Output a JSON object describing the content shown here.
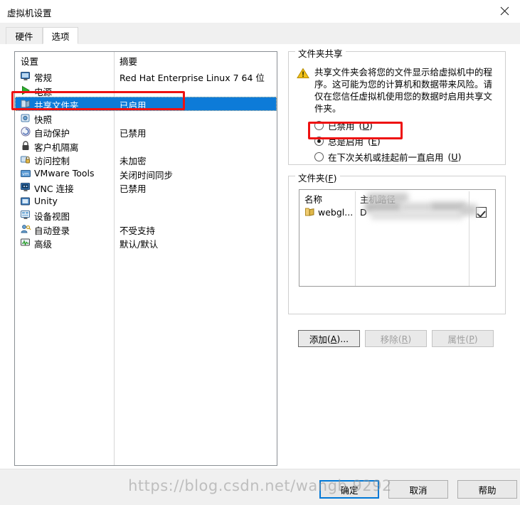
{
  "window": {
    "title": "虚拟机设置",
    "close_icon": "close-icon"
  },
  "tabs": [
    {
      "label": "硬件",
      "active": false
    },
    {
      "label": "选项",
      "active": true
    }
  ],
  "settings_list": {
    "headers": {
      "name": "设置",
      "summary": "摘要"
    },
    "rows": [
      {
        "icon": "monitor-icon",
        "label": "常规",
        "summary": "Red Hat Enterprise Linux 7 64 位",
        "selected": false
      },
      {
        "icon": "play-icon",
        "label": "电源",
        "summary": "",
        "selected": false
      },
      {
        "icon": "folder-icon",
        "label": "共享文件夹",
        "summary": "已启用",
        "selected": true
      },
      {
        "icon": "snapshot-icon",
        "label": "快照",
        "summary": "",
        "selected": false
      },
      {
        "icon": "autoprotect-icon",
        "label": "自动保护",
        "summary": "已禁用",
        "selected": false
      },
      {
        "icon": "lock-icon",
        "label": "客户机隔离",
        "summary": "",
        "selected": false
      },
      {
        "icon": "access-control-icon",
        "label": "访问控制",
        "summary": "未加密",
        "selected": false
      },
      {
        "icon": "vmware-tools-icon",
        "label": "VMware Tools",
        "summary": "关闭时间同步",
        "selected": false
      },
      {
        "icon": "vnc-icon",
        "label": "VNC 连接",
        "summary": "已禁用",
        "selected": false
      },
      {
        "icon": "unity-icon",
        "label": "Unity",
        "summary": "",
        "selected": false
      },
      {
        "icon": "device-view-icon",
        "label": "设备视图",
        "summary": "",
        "selected": false
      },
      {
        "icon": "auto-login-icon",
        "label": "自动登录",
        "summary": "不受支持",
        "selected": false
      },
      {
        "icon": "advanced-icon",
        "label": "高级",
        "summary": "默认/默认",
        "selected": false
      }
    ]
  },
  "sharing": {
    "legend": "文件夹共享",
    "warning_icon": "warning-triangle-icon",
    "warning_text": "共享文件夹会将您的文件显示给虚拟机中的程序。这可能为您的计算机和数据带来风险。请仅在您信任虚拟机使用您的数据时启用共享文件夹。",
    "options": [
      {
        "label": "已禁用",
        "accelerator": "D",
        "selected": false
      },
      {
        "label": "总是启用",
        "accelerator": "E",
        "selected": true
      },
      {
        "label": "在下次关机或挂起前一直启用",
        "accelerator": "U",
        "selected": false
      }
    ]
  },
  "folders": {
    "legend": "文件夹",
    "legend_accelerator": "F",
    "columns": [
      "名称",
      "主机路径"
    ],
    "rows": [
      {
        "icon": "folder-icon",
        "name": "webgl...",
        "path": "D",
        "enabled": true
      }
    ],
    "buttons": [
      {
        "label": "添加",
        "accelerator": "A",
        "suffix": "...",
        "enabled": true
      },
      {
        "label": "移除",
        "accelerator": "R",
        "suffix": "",
        "enabled": false
      },
      {
        "label": "属性",
        "accelerator": "P",
        "suffix": "",
        "enabled": false
      }
    ]
  },
  "footer": {
    "ok": "确定",
    "cancel": "取消",
    "help": "帮助"
  },
  "watermark": "https://blog.csdn.net/wangb    9292",
  "colors": {
    "selection_blue": "#0d7bd8",
    "annotation_red": "#ee1111",
    "focus_blue": "#0078d7",
    "warning_yellow": "#f2c11a"
  }
}
